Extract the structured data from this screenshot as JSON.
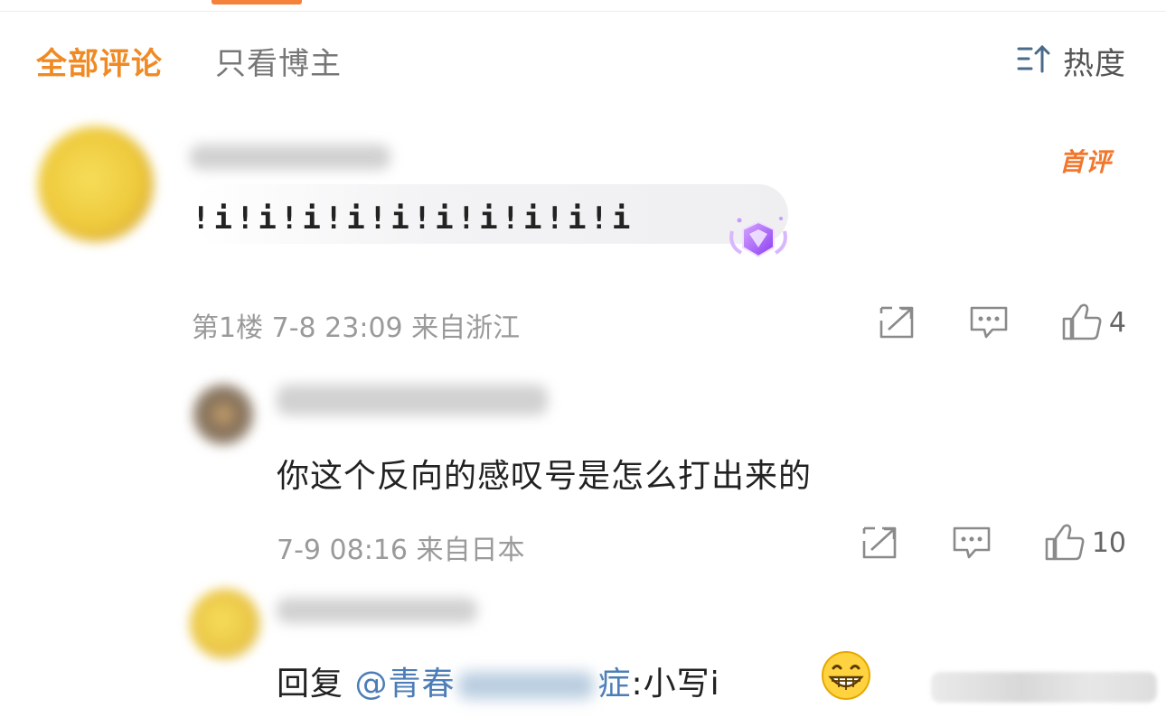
{
  "tabs": [
    {
      "label": "全部评论",
      "active": true
    },
    {
      "label": "只看博主",
      "active": false
    }
  ],
  "sort": {
    "label": "热度",
    "icon": "sort-icon"
  },
  "colors": {
    "accent": "#f08a24",
    "first_badge": "#f2772d",
    "mention": "#4d7db7",
    "meta": "#9a9a9a"
  },
  "comment": {
    "badge": "首评",
    "text": "!i!i!i!i!i!i!i!i!i!i",
    "meta": "第1楼 7-8 23:09 来自浙江",
    "likes": "4",
    "decoration_icon": "diamond-medal-icon"
  },
  "reply1": {
    "text": "你这个反向的感叹号是怎么打出来的",
    "meta": "7-9 08:16 来自日本",
    "likes": "10"
  },
  "reply2": {
    "prefix": "回复 ",
    "mention_start": "@青春",
    "mention_end": "症",
    "suffix": ":小写i",
    "emoji": "grinning-face-emoji"
  },
  "action_icons": [
    "share-icon",
    "comment-icon",
    "like-icon"
  ]
}
